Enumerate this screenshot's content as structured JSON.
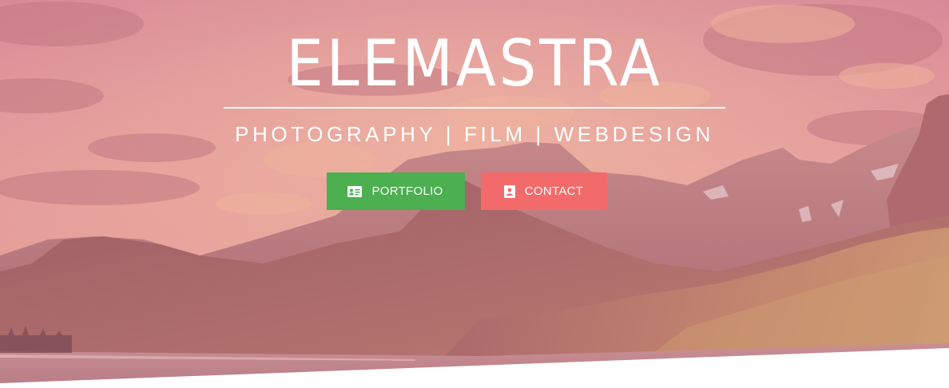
{
  "brand": {
    "title": "ELEMASTRA",
    "tagline": "PHOTOGRAPHY | FILM | WEBDESIGN"
  },
  "actions": {
    "portfolio_label": "PORTFOLIO",
    "contact_label": "CONTACT"
  },
  "colors": {
    "overlay": "#d97a86",
    "portfolio": "#4caf50",
    "contact": "#f36a6a",
    "text": "#ffffff"
  },
  "icons": {
    "portfolio": "id-card-icon",
    "contact": "address-book-icon"
  }
}
